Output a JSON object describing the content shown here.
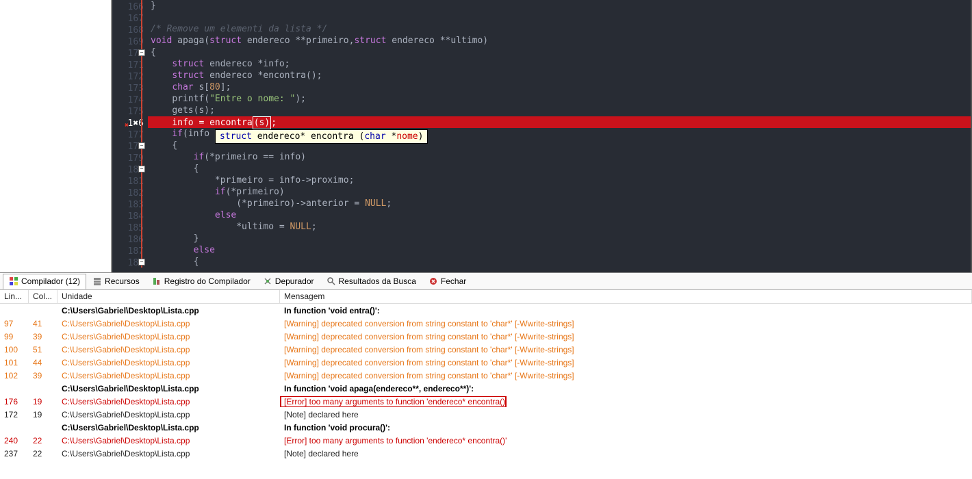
{
  "gutter": {
    "lines": [
      166,
      167,
      168,
      169,
      170,
      171,
      172,
      173,
      174,
      175,
      176,
      177,
      178,
      179,
      180,
      181,
      182,
      183,
      184,
      185,
      186,
      187,
      188
    ],
    "error_line": 176,
    "error_glyph": "1✖6"
  },
  "code": {
    "l166": "}",
    "l167": "",
    "l168_cmt": "/* Remove um elementi da lista */",
    "l169_pre": "void",
    "l169_fn": " apaga(",
    "l169_kw1": "struct",
    "l169_t1": " endereco **primeiro,",
    "l169_kw2": "struct",
    "l169_t2": " endereco **ultimo)",
    "l170": "{",
    "l171_kw": "struct",
    "l171_rest": " endereco *info;",
    "l172_kw": "struct",
    "l172_rest": " endereco *encontra();",
    "l173_kw": "char",
    "l173_mid": " s[",
    "l173_num": "80",
    "l173_end": "];",
    "l174_fn": "printf",
    "l174_open": "(",
    "l174_str": "\"Entre o nome: \"",
    "l174_close": ");",
    "l175": "gets(s);",
    "l176_pre": "info = encontra",
    "l176_paren_open": "(",
    "l176_s": "s",
    "l176_paren_close": ")",
    "l176_semi": ";",
    "l177_kw": "if",
    "l177_rest": "(info",
    "l178": "{",
    "l179_kw": "if",
    "l179_rest": "(*primeiro == info)",
    "l180": "{",
    "l181": "*primeiro = info->proximo;",
    "l182_kw": "if",
    "l182_rest": "(*primeiro)",
    "l183_pre": "(*primeiro)->anterior = ",
    "l183_null": "NULL",
    "l183_end": ";",
    "l184_kw": "else",
    "l185_pre": "*ultimo = ",
    "l185_null": "NULL",
    "l185_end": ";",
    "l186": "}",
    "l187_kw": "else",
    "l188": "{"
  },
  "tooltip": {
    "k1": "struct",
    "t1": " endereco* encontra (",
    "k2": "char",
    "t2": " *",
    "arg": "nome",
    "close": ")"
  },
  "tabs": [
    {
      "label": "Compilador (12)",
      "icon": "compiler-icon",
      "active": true
    },
    {
      "label": "Recursos",
      "icon": "resources-icon"
    },
    {
      "label": "Registro do Compilador",
      "icon": "log-icon"
    },
    {
      "label": "Depurador",
      "icon": "debug-icon"
    },
    {
      "label": "Resultados da Busca",
      "icon": "search-icon"
    },
    {
      "label": "Fechar",
      "icon": "close-icon"
    }
  ],
  "headers": {
    "lin": "Lin...",
    "col": "Col...",
    "unit": "Unidade",
    "msg": "Mensagem"
  },
  "rows": [
    {
      "lin": "",
      "col": "",
      "unit": "C:\\Users\\Gabriel\\Desktop\\Lista.cpp",
      "msg": "In function 'void entra()':",
      "kind": "head"
    },
    {
      "lin": "97",
      "col": "41",
      "unit": "C:\\Users\\Gabriel\\Desktop\\Lista.cpp",
      "msg": "[Warning] deprecated conversion from string constant to 'char*' [-Wwrite-strings]",
      "kind": "warn"
    },
    {
      "lin": "99",
      "col": "39",
      "unit": "C:\\Users\\Gabriel\\Desktop\\Lista.cpp",
      "msg": "[Warning] deprecated conversion from string constant to 'char*' [-Wwrite-strings]",
      "kind": "warn"
    },
    {
      "lin": "100",
      "col": "51",
      "unit": "C:\\Users\\Gabriel\\Desktop\\Lista.cpp",
      "msg": "[Warning] deprecated conversion from string constant to 'char*' [-Wwrite-strings]",
      "kind": "warn"
    },
    {
      "lin": "101",
      "col": "44",
      "unit": "C:\\Users\\Gabriel\\Desktop\\Lista.cpp",
      "msg": "[Warning] deprecated conversion from string constant to 'char*' [-Wwrite-strings]",
      "kind": "warn"
    },
    {
      "lin": "102",
      "col": "39",
      "unit": "C:\\Users\\Gabriel\\Desktop\\Lista.cpp",
      "msg": "[Warning] deprecated conversion from string constant to 'char*' [-Wwrite-strings]",
      "kind": "warn"
    },
    {
      "lin": "",
      "col": "",
      "unit": "C:\\Users\\Gabriel\\Desktop\\Lista.cpp",
      "msg": "In function 'void apaga(endereco**, endereco**)':",
      "kind": "head"
    },
    {
      "lin": "176",
      "col": "19",
      "unit": "C:\\Users\\Gabriel\\Desktop\\Lista.cpp",
      "msg": "[Error] too many arguments to function 'endereco* encontra()'",
      "kind": "err",
      "boxed": true
    },
    {
      "lin": "172",
      "col": "19",
      "unit": "C:\\Users\\Gabriel\\Desktop\\Lista.cpp",
      "msg": "[Note] declared here",
      "kind": "note"
    },
    {
      "lin": "",
      "col": "",
      "unit": "C:\\Users\\Gabriel\\Desktop\\Lista.cpp",
      "msg": "In function 'void procura()':",
      "kind": "head"
    },
    {
      "lin": "240",
      "col": "22",
      "unit": "C:\\Users\\Gabriel\\Desktop\\Lista.cpp",
      "msg": "[Error] too many arguments to function 'endereco* encontra()'",
      "kind": "err"
    },
    {
      "lin": "237",
      "col": "22",
      "unit": "C:\\Users\\Gabriel\\Desktop\\Lista.cpp",
      "msg": "[Note] declared here",
      "kind": "note"
    }
  ]
}
